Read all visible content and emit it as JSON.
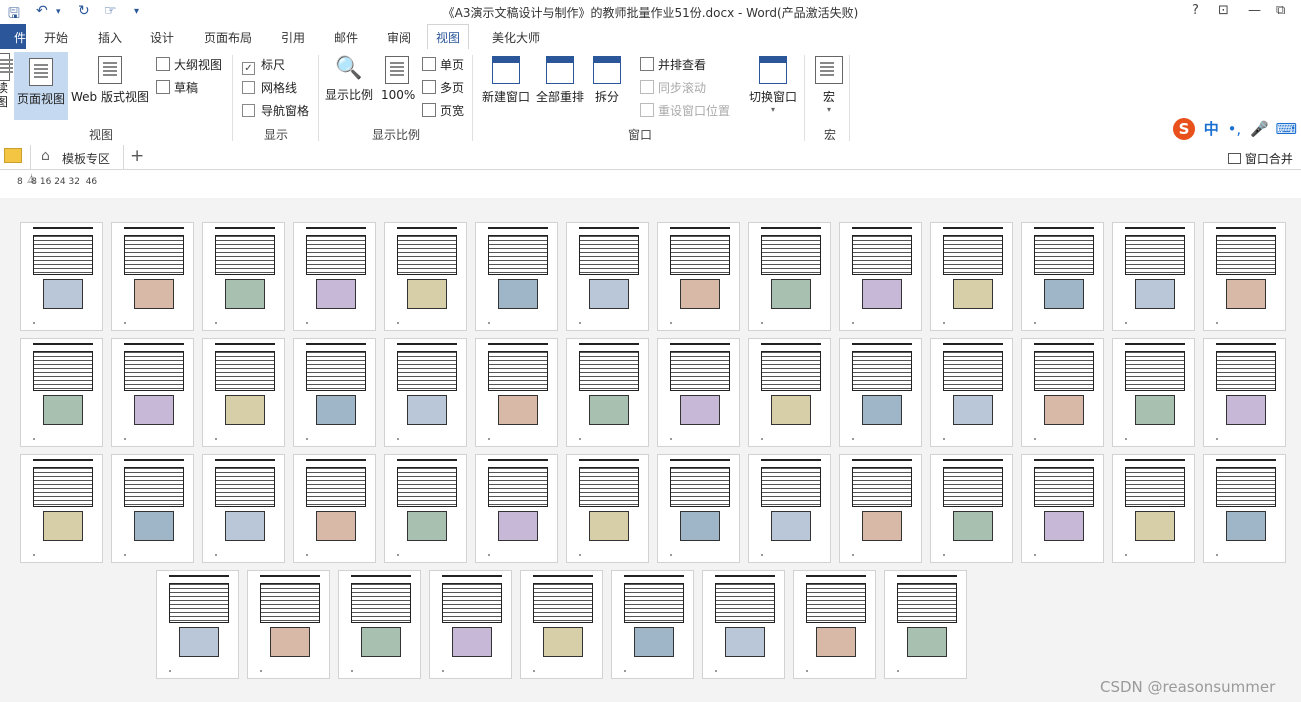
{
  "window": {
    "title": "《A3演示文稿设计与制作》的教师批量作业51份.docx - Word(产品激活失败)",
    "controls": [
      "?",
      "⊡",
      "—",
      "⧉"
    ]
  },
  "tabs": [
    {
      "label": "件",
      "active": false,
      "file": true
    },
    {
      "label": "开始",
      "active": false
    },
    {
      "label": "插入",
      "active": false
    },
    {
      "label": "设计",
      "active": false
    },
    {
      "label": "页面布局",
      "active": false
    },
    {
      "label": "引用",
      "active": false
    },
    {
      "label": "邮件",
      "active": false
    },
    {
      "label": "审阅",
      "active": false
    },
    {
      "label": "视图",
      "active": true
    },
    {
      "label": "美化大师",
      "active": false
    }
  ],
  "ribbon": {
    "view_group": {
      "label": "视图",
      "read_mode_fragment": "读\n图",
      "page_view": "页面视图",
      "web_view": "Web 版式视图",
      "outline": "大纲视图",
      "draft": "草稿"
    },
    "show_group": {
      "label": "显示",
      "ruler": "标尺",
      "ruler_checked": true,
      "gridlines": "网格线",
      "gridlines_checked": false,
      "nav_pane": "导航窗格",
      "nav_pane_checked": false
    },
    "zoom_group": {
      "label": "显示比例",
      "zoom": "显示比例",
      "hundred": "100%",
      "one_page": "单页",
      "multi_page": "多页",
      "page_width": "页宽"
    },
    "window_group": {
      "label": "窗口",
      "new_window": "新建窗口",
      "arrange_all": "全部重排",
      "split": "拆分",
      "side_by_side": "并排查看",
      "sync_scroll": "同步滚动",
      "reset_position": "重设窗口位置",
      "switch_windows": "切换窗口"
    },
    "macro_group": {
      "label": "宏",
      "macros": "宏"
    }
  },
  "doc_tabs": {
    "template_zone": "模板专区",
    "add": "+",
    "merge_windows": "窗口合并"
  },
  "ime": {
    "logo": "S",
    "lang": "中",
    "punct": "•,"
  },
  "ruler": {
    "labels": "8   8 16 24 32  46"
  },
  "document": {
    "page_count": 51
  },
  "watermark": "CSDN @reasonsummer"
}
